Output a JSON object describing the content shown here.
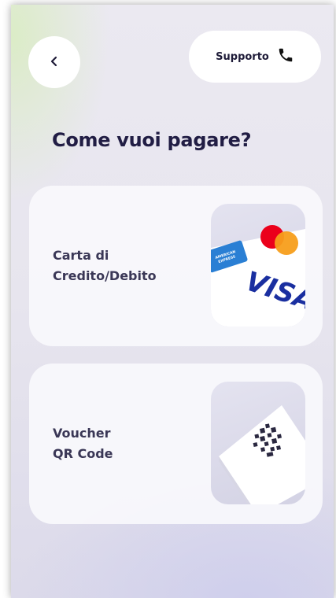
{
  "header": {
    "back_icon": "chevron-left-icon",
    "support_label": "Supporto",
    "support_icon": "phone-icon"
  },
  "main": {
    "title": "Come vuoi pagare?",
    "options": [
      {
        "label": "Carta di\nCredito/Debito",
        "icon": "credit-cards-icon",
        "visa_text": "VISA",
        "amex_text": "AMERICAN EXPRESS"
      },
      {
        "label": "Voucher\nQR Code",
        "icon": "qr-code-icon"
      }
    ]
  },
  "colors": {
    "title": "#211d44",
    "card_label": "#3a3756",
    "card_bg": "#f9f8fc",
    "visa_blue": "#1a2fa0",
    "amex_blue": "#2a7fd4",
    "mastercard_red": "#eb001b",
    "mastercard_orange": "#f79e1b"
  }
}
